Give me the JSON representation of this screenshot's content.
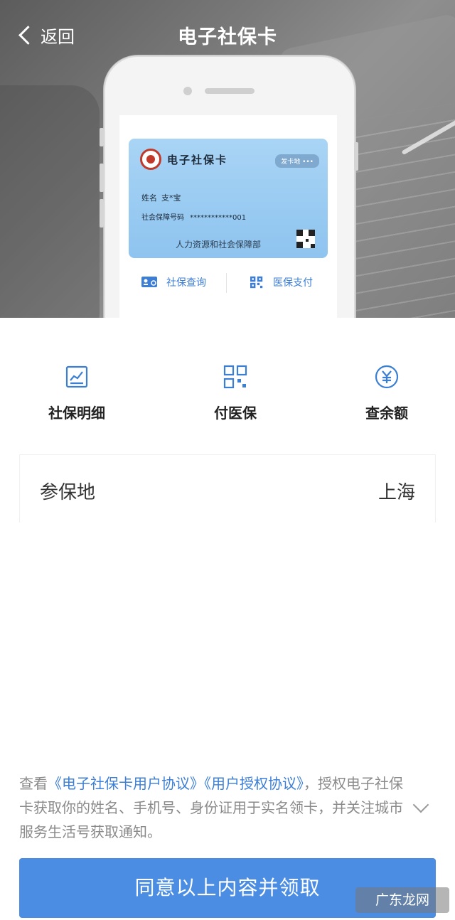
{
  "header": {
    "back_label": "返回",
    "title": "电子社保卡"
  },
  "social_card": {
    "title": "电子社保卡",
    "issuer_badge": "发卡地 •••",
    "name_label": "姓名",
    "name_value": "支*宝",
    "number_label": "社会保障号码",
    "number_value": "************001",
    "department": "人力资源和社会保障部",
    "actions": [
      {
        "label": "社保查询",
        "icon": "id-card-search-icon"
      },
      {
        "label": "医保支付",
        "icon": "qr-grid-icon"
      }
    ]
  },
  "features": [
    {
      "label": "社保明细",
      "icon": "chart-icon"
    },
    {
      "label": "付医保",
      "icon": "grid-icon"
    },
    {
      "label": "查余额",
      "icon": "yen-icon"
    }
  ],
  "location": {
    "label": "参保地",
    "value": "上海"
  },
  "agreement": {
    "prefix": "查看",
    "link1": "《电子社保卡用户协议》",
    "link2": "《用户授权协议》",
    "suffix": "，授权电子社保卡获取你的姓名、手机号、身份证用于实名领卡，并关注城市服务生活号获取通知。"
  },
  "claim_button": "同意以上内容并领取",
  "watermark": "广东龙网",
  "colors": {
    "accent": "#3b7fd4",
    "button": "#4a8de3"
  }
}
